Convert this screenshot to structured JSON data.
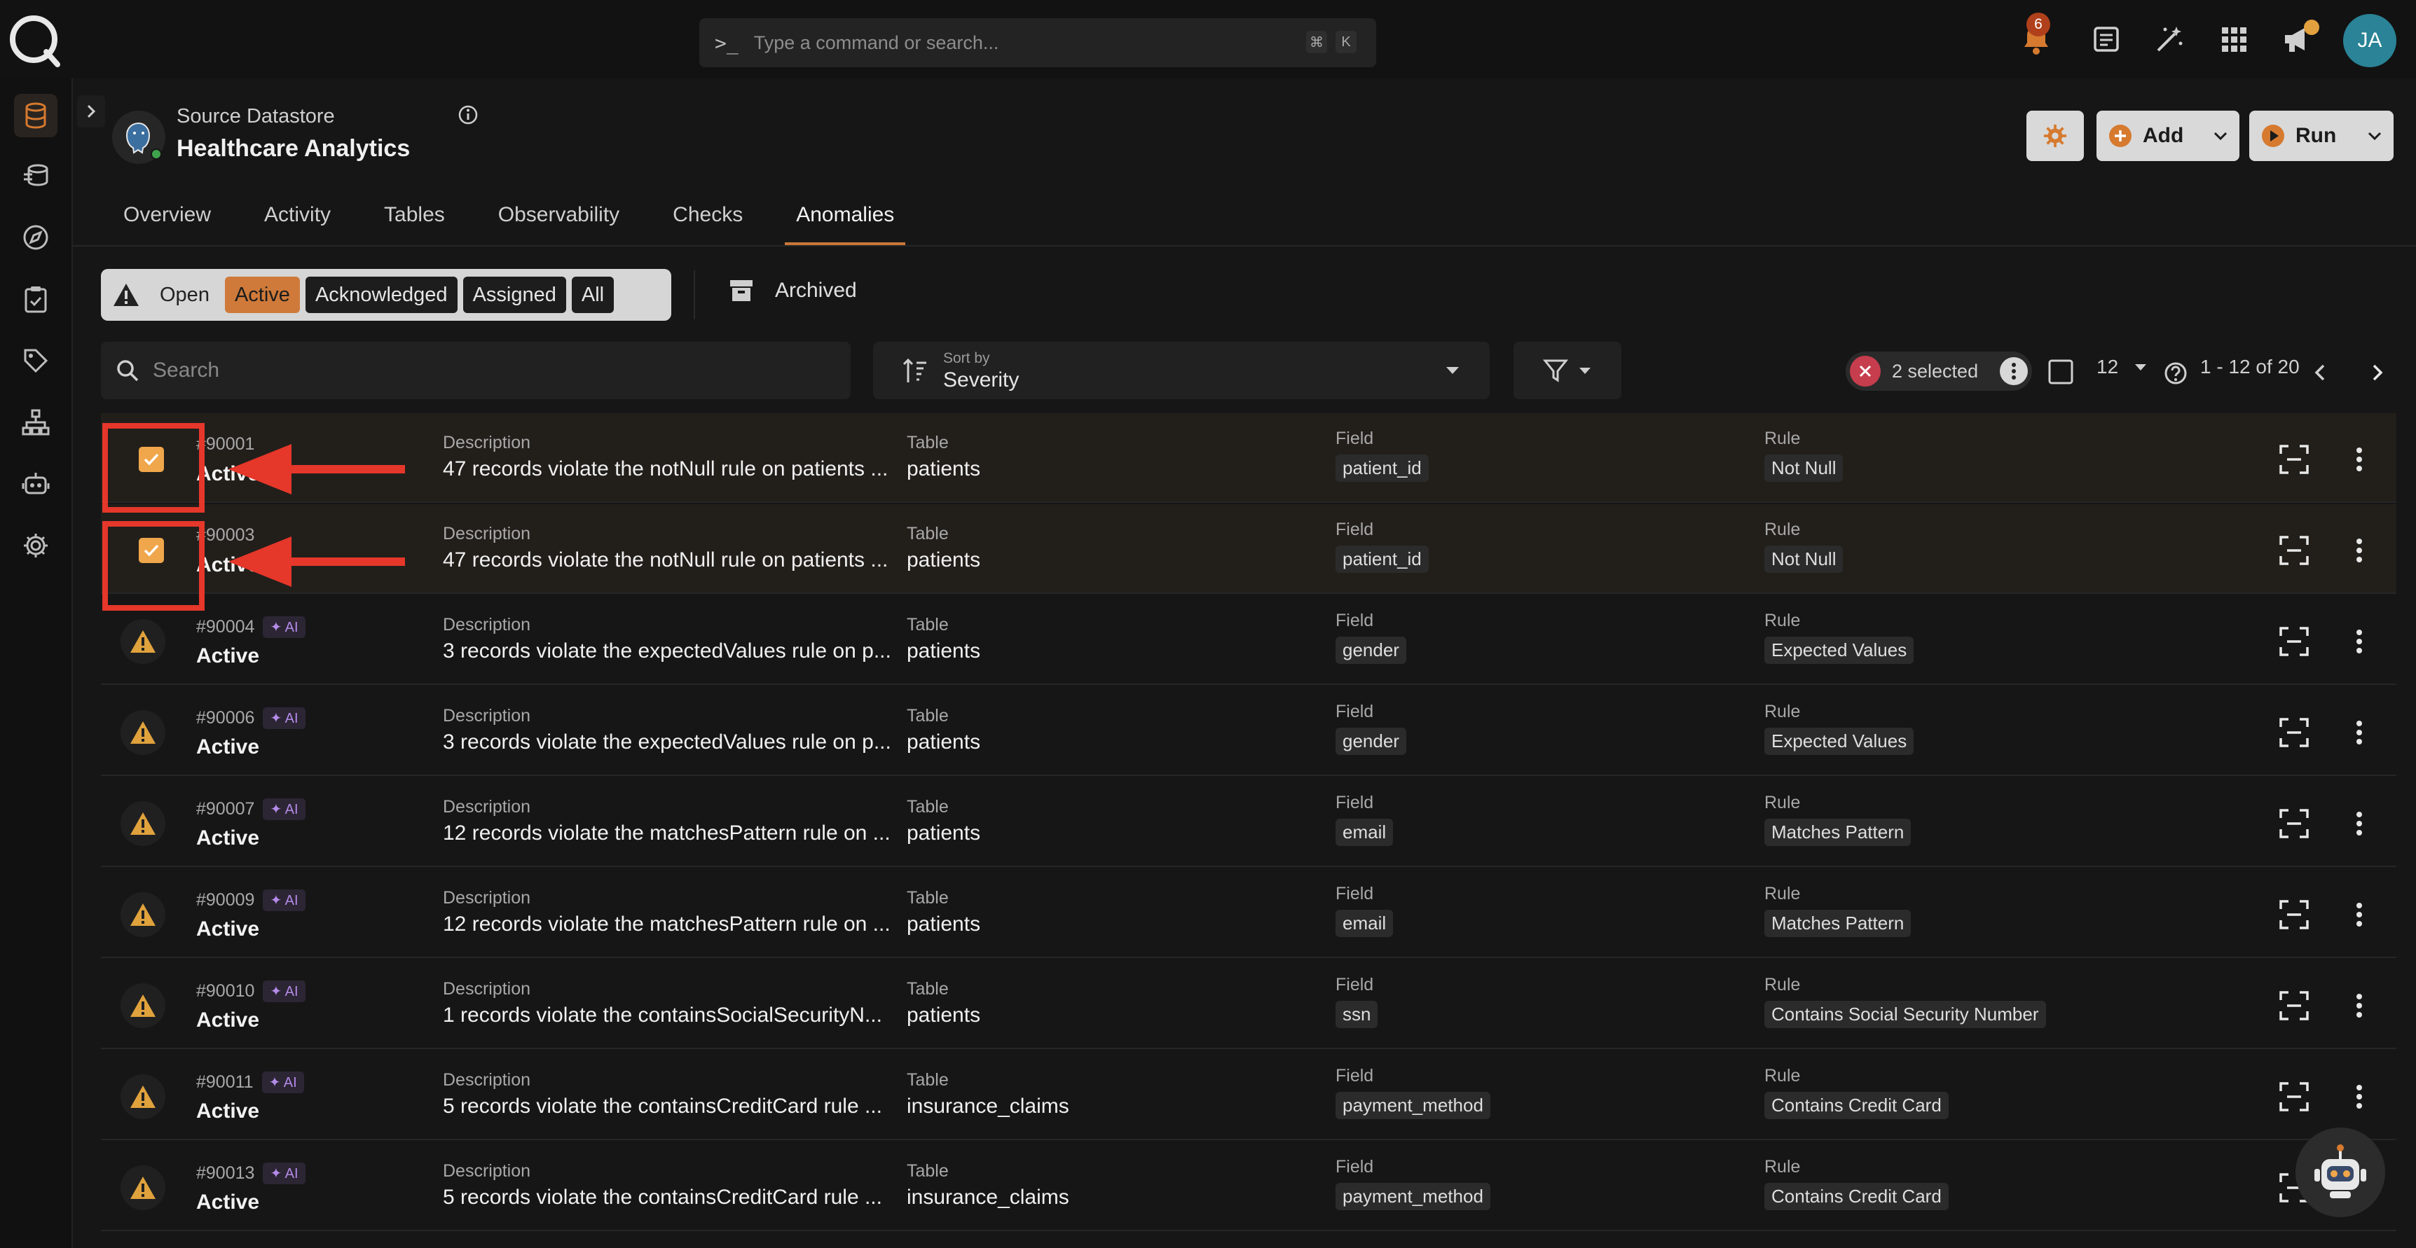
{
  "topbar": {
    "command_placeholder": "Type a command or search...",
    "shortcut_mod": "⌘",
    "shortcut_key": "K",
    "notification_count": "6",
    "user_initials": "JA"
  },
  "sidebar": {
    "items": [
      {
        "name": "datastores",
        "icon": "database-icon",
        "active": true
      },
      {
        "name": "enrichment",
        "icon": "layers-icon",
        "active": false
      },
      {
        "name": "explore",
        "icon": "compass-icon",
        "active": false
      },
      {
        "name": "checks",
        "icon": "clipboard-check-icon",
        "active": false
      },
      {
        "name": "tags",
        "icon": "tag-icon",
        "active": false
      },
      {
        "name": "flows",
        "icon": "hierarchy-icon",
        "active": false
      },
      {
        "name": "agents",
        "icon": "robot-icon",
        "active": false
      },
      {
        "name": "settings",
        "icon": "gear-icon",
        "active": false
      }
    ]
  },
  "header": {
    "datastore_type": "Source Datastore",
    "datastore_name": "Healthcare Analytics",
    "add_label": "Add",
    "run_label": "Run"
  },
  "tabs": [
    "Overview",
    "Activity",
    "Tables",
    "Observability",
    "Checks",
    "Anomalies"
  ],
  "active_tab": "Anomalies",
  "status_filter": {
    "open_label": "Open",
    "options": [
      "Active",
      "Acknowledged",
      "Assigned",
      "All"
    ],
    "selected": "Active",
    "archived_label": "Archived"
  },
  "search": {
    "placeholder": "Search"
  },
  "sort": {
    "label": "Sort by",
    "value": "Severity"
  },
  "selection": {
    "text": "2 selected"
  },
  "pagination": {
    "page_size": "12",
    "range": "1 - 12 of 20"
  },
  "columns": {
    "description": "Description",
    "table": "Table",
    "field": "Field",
    "rule": "Rule"
  },
  "rows": [
    {
      "id": "#90001",
      "status": "Active",
      "ai": false,
      "selected": true,
      "description": "47 records violate the notNull rule on patients ...",
      "table": "patients",
      "field": "patient_id",
      "rule": "Not Null"
    },
    {
      "id": "#90003",
      "status": "Active",
      "ai": false,
      "selected": true,
      "description": "47 records violate the notNull rule on patients ...",
      "table": "patients",
      "field": "patient_id",
      "rule": "Not Null"
    },
    {
      "id": "#90004",
      "status": "Active",
      "ai": true,
      "selected": false,
      "description": "3 records violate the expectedValues rule on p...",
      "table": "patients",
      "field": "gender",
      "rule": "Expected Values"
    },
    {
      "id": "#90006",
      "status": "Active",
      "ai": true,
      "selected": false,
      "description": "3 records violate the expectedValues rule on p...",
      "table": "patients",
      "field": "gender",
      "rule": "Expected Values"
    },
    {
      "id": "#90007",
      "status": "Active",
      "ai": true,
      "selected": false,
      "description": "12 records violate the matchesPattern rule on ...",
      "table": "patients",
      "field": "email",
      "rule": "Matches Pattern"
    },
    {
      "id": "#90009",
      "status": "Active",
      "ai": true,
      "selected": false,
      "description": "12 records violate the matchesPattern rule on ...",
      "table": "patients",
      "field": "email",
      "rule": "Matches Pattern"
    },
    {
      "id": "#90010",
      "status": "Active",
      "ai": true,
      "selected": false,
      "description": "1 records violate the containsSocialSecurityN...",
      "table": "patients",
      "field": "ssn",
      "rule": "Contains Social Security Number"
    },
    {
      "id": "#90011",
      "status": "Active",
      "ai": true,
      "selected": false,
      "description": "5 records violate the containsCreditCard rule ...",
      "table": "insurance_claims",
      "field": "payment_method",
      "rule": "Contains Credit Card"
    },
    {
      "id": "#90013",
      "status": "Active",
      "ai": true,
      "selected": false,
      "description": "5 records violate the containsCreditCard rule ...",
      "table": "insurance_claims",
      "field": "payment_method",
      "rule": "Contains Credit Card"
    }
  ],
  "ai_badge": "✦ AI",
  "colors": {
    "accent": "#cf7a3a",
    "checkbox": "#f0a64b",
    "warning": "#e0a23c",
    "highlight": "#e5372a",
    "ai": "#b48be8"
  }
}
